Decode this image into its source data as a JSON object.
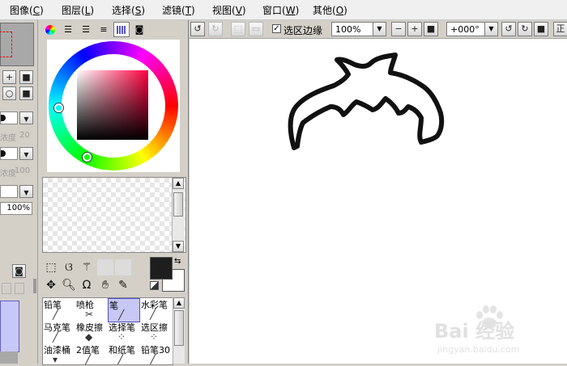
{
  "menu": {
    "items": [
      {
        "label": "图像",
        "shortcut": "C"
      },
      {
        "label": "图层",
        "shortcut": "L"
      },
      {
        "label": "选择",
        "shortcut": "S"
      },
      {
        "label": "滤镜",
        "shortcut": "T"
      },
      {
        "label": "视图",
        "shortcut": "V"
      },
      {
        "label": "窗口",
        "shortcut": "W"
      },
      {
        "label": "其他",
        "shortcut": "O"
      }
    ]
  },
  "left_panel": {
    "density_label_1": "浓度",
    "density_value_1": "20",
    "density_label_2": "浓度",
    "density_value_2": "100",
    "opacity_value": "100%"
  },
  "color_panel": {
    "tabs": [
      "color-wheel",
      "rgb-sliders",
      "hsv-sliders",
      "swatch-bars",
      "swatch-grid",
      "scratchpad"
    ],
    "active_tab": "swatch-grid",
    "foreground_color": "#1e1e1e",
    "background_color": "#ffffff"
  },
  "tools": {
    "icons": [
      "rect-select-icon",
      "lasso-icon",
      "magic-wand-icon",
      "move-icon",
      "zoom-icon",
      "rotate-icon",
      "hand-icon",
      "eyedropper-icon"
    ]
  },
  "brushes": {
    "items": [
      {
        "label": "铅笔"
      },
      {
        "label": "喷枪"
      },
      {
        "label": "笔",
        "active": true
      },
      {
        "label": "水彩笔"
      },
      {
        "label": "马克笔"
      },
      {
        "label": "橡皮擦"
      },
      {
        "label": "选择笔"
      },
      {
        "label": "选区擦"
      },
      {
        "label": "油漆桶"
      },
      {
        "label": "2值笔"
      },
      {
        "label": "和纸笔"
      },
      {
        "label": "铅笔30"
      }
    ]
  },
  "canvas_toolbar": {
    "selection_edge_label": "选区边缘",
    "selection_edge_checked": true,
    "zoom_value": "100%",
    "rotation_value": "+000°",
    "right_edge_text": "正"
  },
  "watermark": {
    "main": "Bai 经验",
    "sub": "jingyan.baidu.com"
  }
}
